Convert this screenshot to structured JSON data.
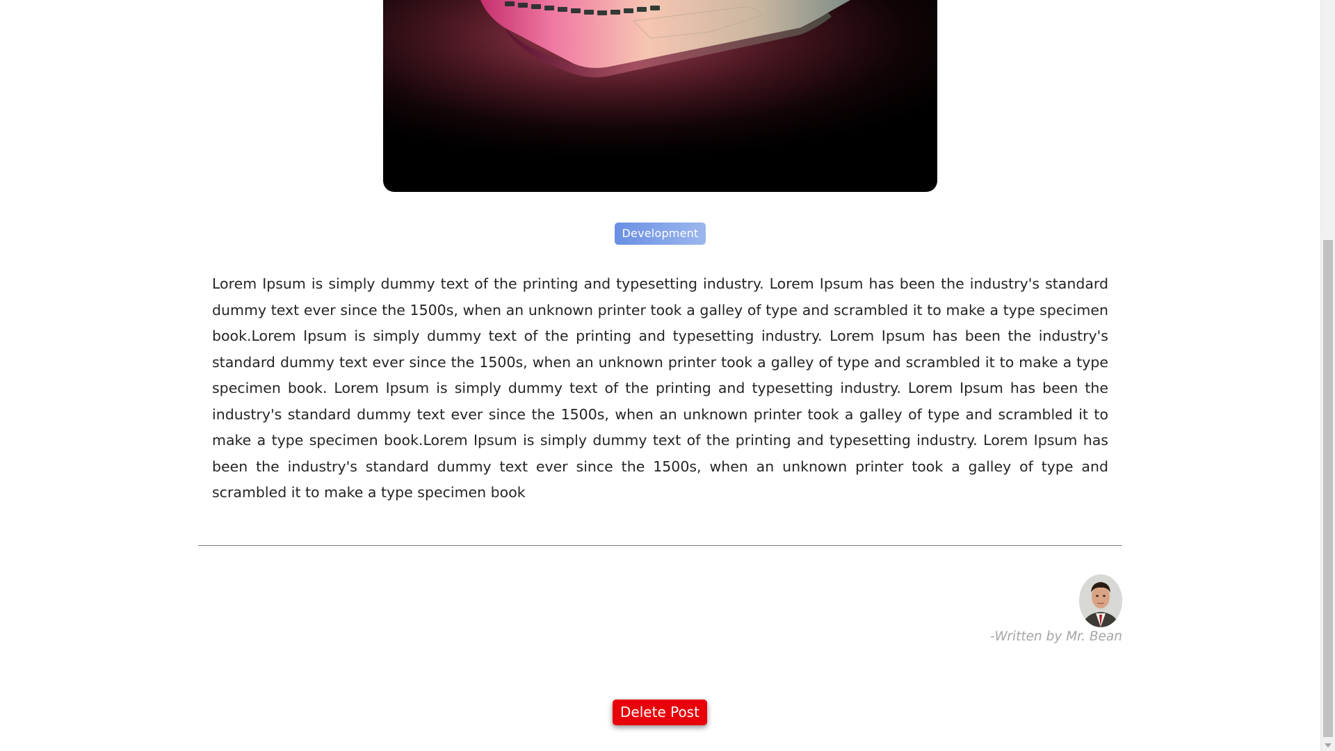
{
  "post": {
    "category": "Development",
    "body": "Lorem Ipsum is simply dummy text of the printing and typesetting industry. Lorem Ipsum has been the industry's standard dummy text ever since the 1500s, when an unknown printer took a galley of type and scrambled it to make a type specimen book.Lorem Ipsum is simply dummy text of the printing and typesetting industry. Lorem Ipsum has been the industry's standard dummy text ever since the 1500s, when an unknown printer took a galley of type and scrambled it to make a type specimen book. Lorem Ipsum is simply dummy text of the printing and typesetting industry. Lorem Ipsum has been the industry's standard dummy text ever since the 1500s, when an unknown printer took a galley of type and scrambled it to make a type specimen book.Lorem Ipsum is simply dummy text of the printing and typesetting industry. Lorem Ipsum has been the industry's standard dummy text ever since the 1500s, when an unknown printer took a galley of type and scrambled it to make a type specimen book",
    "byline": "-Written by Mr. Bean"
  },
  "actions": {
    "delete_label": "Delete Post"
  },
  "colors": {
    "badge": "#7a9de8",
    "delete": "#e8000b",
    "byline": "#a5a5a5"
  }
}
